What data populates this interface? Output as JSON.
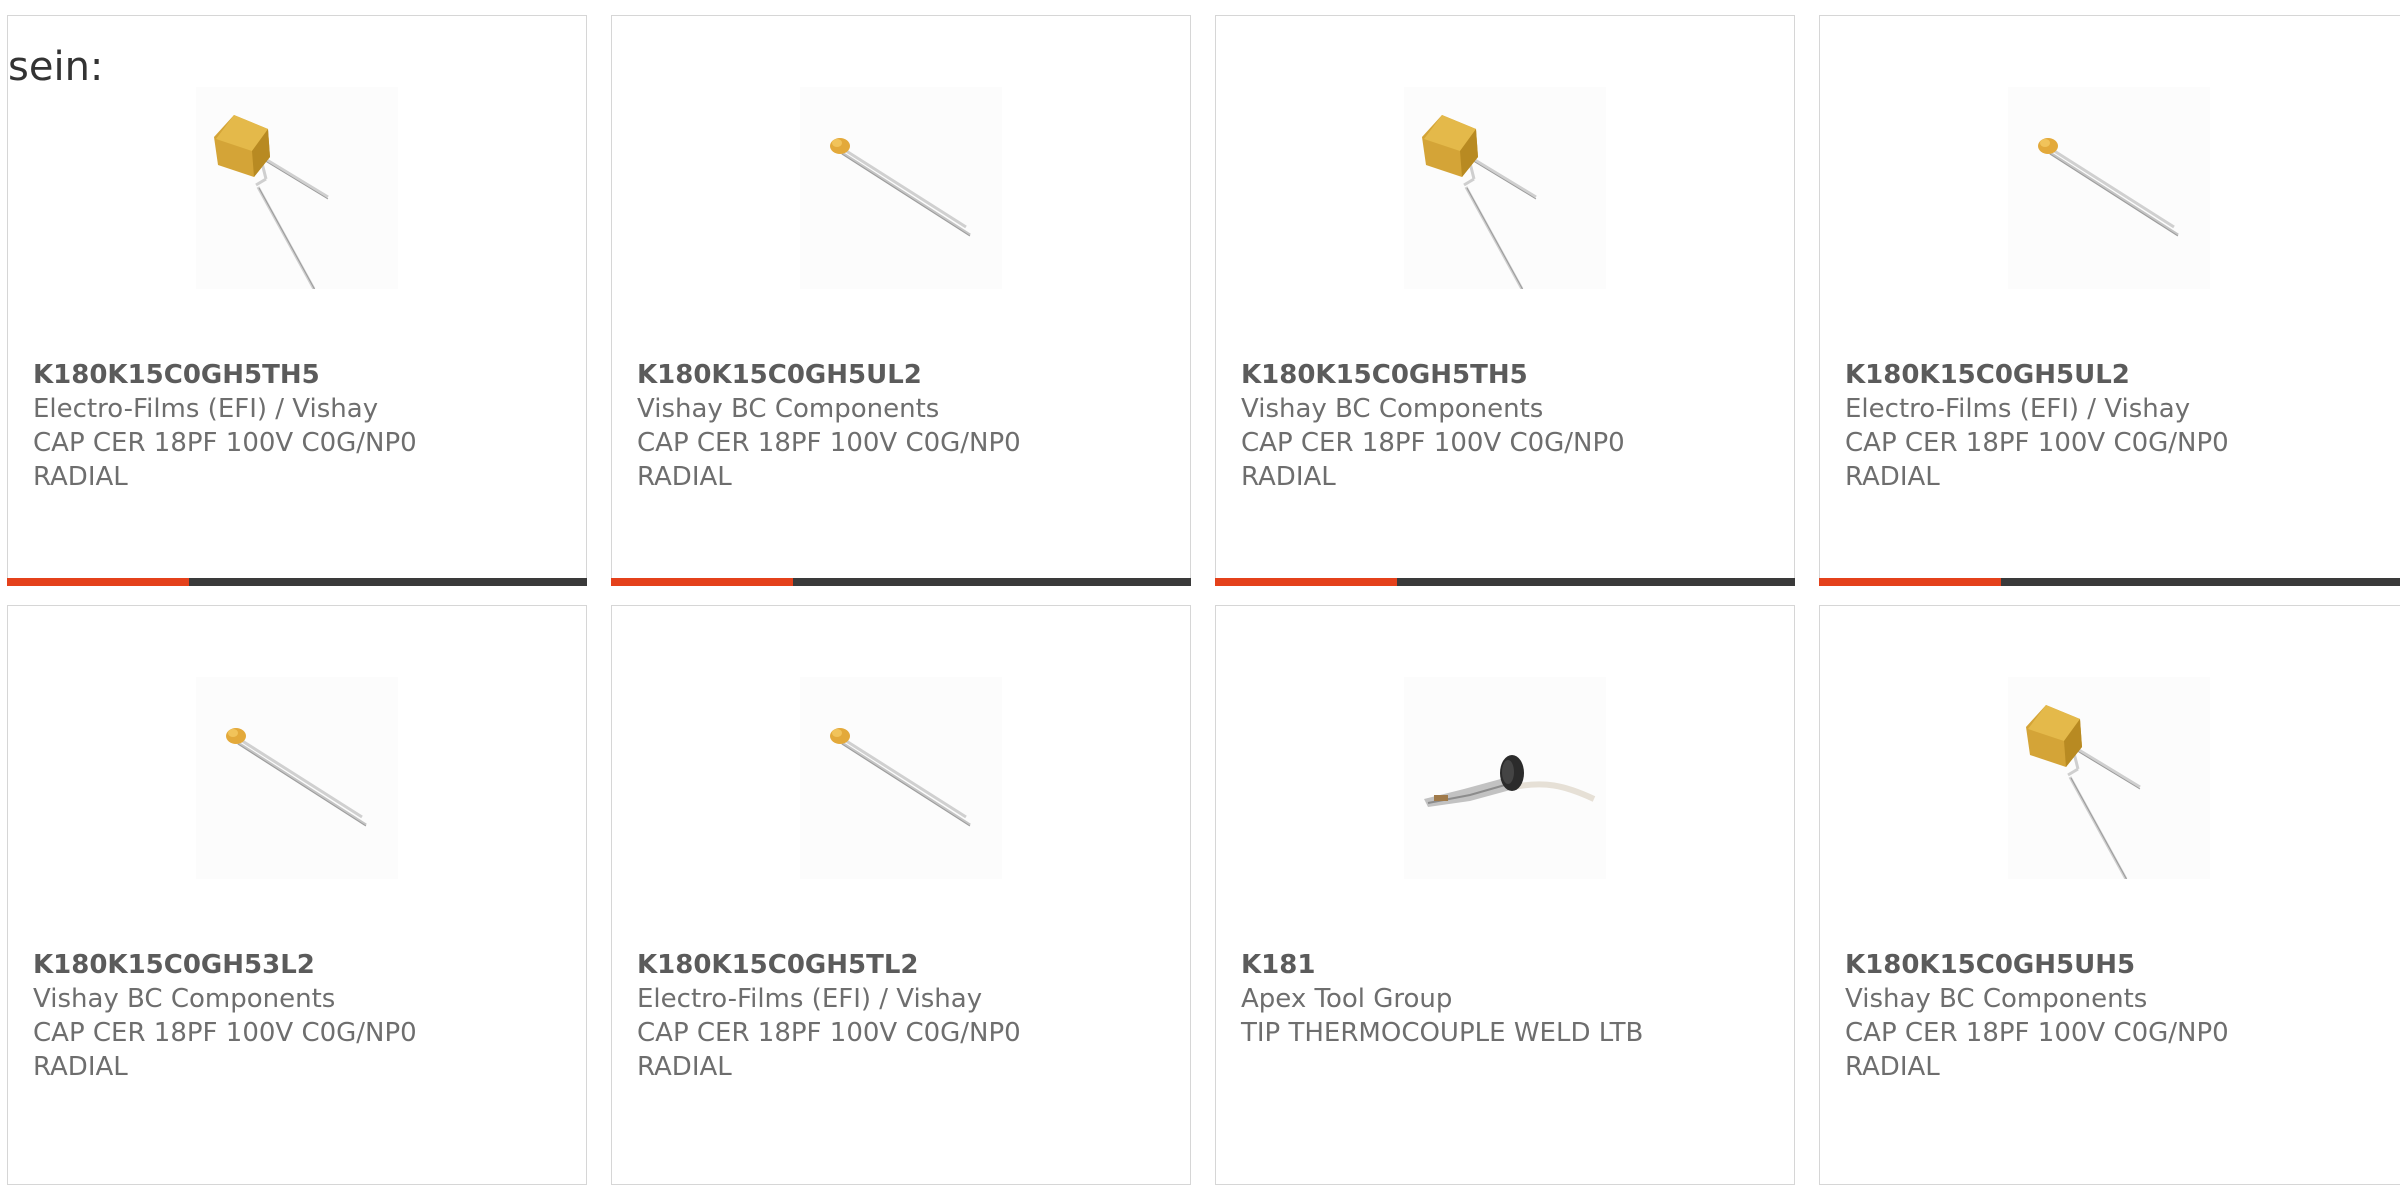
{
  "intro_text": "sein:",
  "accent_color": "#e4411b",
  "bar_color": "#3a3a3a",
  "products": [
    {
      "part_number": "K180K15C0GH5TH5",
      "manufacturer": "Electro-Films (EFI) / Vishay",
      "description_line1": "CAP CER 18PF 100V C0G/NP0",
      "description_line2": "RADIAL",
      "image": "box-capacitor-image"
    },
    {
      "part_number": "K180K15C0GH5UL2",
      "manufacturer": "Vishay BC Components",
      "description_line1": "CAP CER 18PF 100V C0G/NP0",
      "description_line2": "RADIAL",
      "image": "bead-capacitor-image"
    },
    {
      "part_number": "K180K15C0GH5TH5",
      "manufacturer": "Vishay BC Components",
      "description_line1": "CAP CER 18PF 100V C0G/NP0",
      "description_line2": "RADIAL",
      "image": "box-capacitor-image"
    },
    {
      "part_number": "K180K15C0GH5UL2",
      "manufacturer": "Electro-Films (EFI) / Vishay",
      "description_line1": "CAP CER 18PF 100V C0G/NP0",
      "description_line2": "RADIAL",
      "image": "bead-capacitor-image"
    },
    {
      "part_number": "K180K15C0GH53L2",
      "manufacturer": "Vishay BC Components",
      "description_line1": "CAP CER 18PF 100V C0G/NP0",
      "description_line2": "RADIAL",
      "image": "bead-capacitor-image"
    },
    {
      "part_number": "K180K15C0GH5TL2",
      "manufacturer": "Electro-Films (EFI) / Vishay",
      "description_line1": "CAP CER 18PF 100V C0G/NP0",
      "description_line2": "RADIAL",
      "image": "bead-capacitor-image"
    },
    {
      "part_number": "K181",
      "manufacturer": "Apex Tool Group",
      "description_line1": "TIP THERMOCOUPLE WELD LTB",
      "description_line2": "",
      "image": "thermocouple-tip-image"
    },
    {
      "part_number": "K180K15C0GH5UH5",
      "manufacturer": "Vishay BC Components",
      "description_line1": "CAP CER 18PF 100V C0G/NP0",
      "description_line2": "RADIAL",
      "image": "box-capacitor-image"
    }
  ]
}
